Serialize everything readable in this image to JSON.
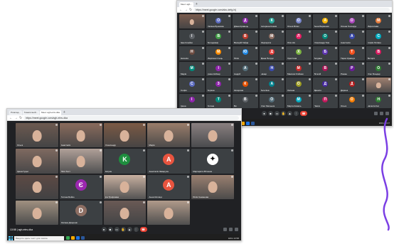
{
  "colors": {
    "meet_bg": "#202124",
    "tile_bg": "#3c4043",
    "end_call": "#ea4335",
    "squiggle": "#7b3fe4",
    "taskbar": "#1f1f1f"
  },
  "back_window": {
    "tabs": [
      "Meet: agh..."
    ],
    "address": "https://meet.google.com/abc-defg-hij",
    "bottom_left": "13:27 | agh-etnv-dka",
    "taskbar_search": "Введите здесь текст для поиска",
    "tray": "ENG 13:27",
    "tiles": [
      {
        "name": "",
        "type": "cam",
        "c": "#7a5c4e"
      },
      {
        "name": "Оксана Бушкова",
        "type": "av",
        "l": "О",
        "c": "#5c6bc0"
      },
      {
        "name": "Діана Кравець",
        "type": "av",
        "l": "Д",
        "c": "#8e24aa"
      },
      {
        "name": "Катерина Кожма",
        "type": "av",
        "l": "К",
        "c": "#26a69a"
      },
      {
        "name": "Ольга Білик",
        "type": "av",
        "l": "О",
        "c": "#7986cb"
      },
      {
        "name": "Анна Баранник",
        "type": "av",
        "l": "А",
        "c": "#f4b400"
      },
      {
        "name": "Олена Гончарук",
        "type": "av",
        "l": "О",
        "c": "#ab47bc"
      },
      {
        "name": "Мирослава",
        "type": "av",
        "l": "М",
        "c": "#e67c3c"
      },
      {
        "name": "Іван Клюйко",
        "type": "av",
        "l": "І",
        "c": "#5f6368"
      },
      {
        "name": "Володимир",
        "type": "av",
        "l": "В",
        "c": "#43a047"
      },
      {
        "name": "Валерій Гайда",
        "type": "av",
        "l": "В",
        "c": "#c0392b"
      },
      {
        "name": "Маргарита",
        "type": "av",
        "l": "М",
        "c": "#8d6e63"
      },
      {
        "name": "Ліля Ніч",
        "type": "av",
        "l": "Л",
        "c": "#e91e63"
      },
      {
        "name": "Олександр Тим",
        "type": "av",
        "l": "О",
        "c": "#00897b"
      },
      {
        "name": "Анастасія",
        "type": "av",
        "l": "А",
        "c": "#3949ab"
      },
      {
        "name": "Софія Литвин",
        "type": "av",
        "l": "С",
        "c": "#00acc1"
      },
      {
        "name": "Наталія",
        "type": "av",
        "l": "Н",
        "c": "#6d4c41"
      },
      {
        "name": "Мартина Стець",
        "type": "av",
        "l": "М",
        "c": "#fb8c00"
      },
      {
        "name": "Юлія",
        "type": "av",
        "l": "Ю",
        "c": "#1e88e5"
      },
      {
        "name": "Діана Петрук",
        "type": "av",
        "l": "Д",
        "c": "#e53935"
      },
      {
        "name": "Христина",
        "type": "av",
        "l": "Х",
        "c": "#7cb342"
      },
      {
        "name": "Богдана",
        "type": "av",
        "l": "Б",
        "c": "#5e35b1"
      },
      {
        "name": "Тарас Кравчук",
        "type": "av",
        "l": "Т",
        "c": "#f4511e"
      },
      {
        "name": "Вікторія",
        "type": "av",
        "l": "В",
        "c": "#d81b60"
      },
      {
        "name": "Марія",
        "type": "av",
        "l": "М",
        "c": "#00897b"
      },
      {
        "name": "Ірина Кобзар",
        "type": "av",
        "l": "І",
        "c": "#8e24aa"
      },
      {
        "name": "Андрій",
        "type": "av",
        "l": "А",
        "c": "#546e7a"
      },
      {
        "name": "Назар",
        "type": "av",
        "l": "Н",
        "c": "#3949ab"
      },
      {
        "name": "Максим Олійник",
        "type": "av",
        "l": "М",
        "c": "#c62828"
      },
      {
        "name": "Віталій",
        "type": "av",
        "l": "В",
        "c": "#ad1457"
      },
      {
        "name": "Роман",
        "type": "av",
        "l": "Р",
        "c": "#6a1b9a"
      },
      {
        "name": "Олег Бондар",
        "type": "av",
        "l": "О",
        "c": "#2e7d32"
      },
      {
        "name": "Софія",
        "type": "av",
        "l": "С",
        "c": "#5c6bc0"
      },
      {
        "name": "Зоряна",
        "type": "av",
        "l": "З",
        "c": "#8e24aa"
      },
      {
        "name": "Катерина",
        "type": "av",
        "l": "К",
        "c": "#e65100"
      },
      {
        "name": "Ангеліна",
        "type": "av",
        "l": "А",
        "c": "#00838f"
      },
      {
        "name": "Оксана",
        "type": "av",
        "l": "О",
        "c": "#9e9d24"
      },
      {
        "name": "Данило",
        "type": "av",
        "l": "Д",
        "c": "#4527a0"
      },
      {
        "name": "Дарина",
        "type": "av",
        "l": "Д",
        "c": "#b71c1c"
      },
      {
        "name": "",
        "type": "cam",
        "c": "#a08070"
      },
      {
        "name": "Ірина",
        "type": "av",
        "l": "І",
        "c": "#8e24aa"
      },
      {
        "name": "Тетяна",
        "type": "av",
        "l": "Т",
        "c": "#00897b"
      },
      {
        "name": "Ви",
        "type": "av",
        "l": "В",
        "c": "#5f6368"
      },
      {
        "name": "Олег Мельник",
        "type": "av",
        "l": "О",
        "c": "#546e7a"
      },
      {
        "name": "Марта Коваль",
        "type": "av",
        "l": "М",
        "c": "#00acc1"
      },
      {
        "name": "Павло",
        "type": "av",
        "l": "П",
        "c": "#c2185b"
      },
      {
        "name": "Ольга",
        "type": "av",
        "l": "О",
        "c": "#f57c00"
      },
      {
        "name": "Наталія Кос",
        "type": "av",
        "l": "Н",
        "c": "#2e7d32"
      }
    ]
  },
  "front_window": {
    "tabs": [
      "Розклад...",
      "Тематичний...",
      "Meet: agh-etnv-dka"
    ],
    "address": "https://meet.google.com/agh-etnv-dka",
    "bottom_left": "13:58 | agh-etnv-dka",
    "taskbar_search": "Введите здесь текст для поиска",
    "tray": "ENG 13:58",
    "tiles": [
      {
        "name": "Ольга",
        "type": "cam",
        "c": "#6d5a50"
      },
      {
        "name": "Анастасія",
        "type": "cam",
        "c": "#8a6b5c"
      },
      {
        "name": "Олександр",
        "type": "cam",
        "c": "#7c5a45"
      },
      {
        "name": "Марія",
        "type": "cam",
        "c": "#9a7d6a"
      },
      {
        "name": "",
        "type": "cam",
        "c": "#8a8080"
      },
      {
        "name": "Ірина Гуцал",
        "type": "cam",
        "c": "#7f6a60"
      },
      {
        "name": "Ліля Тест",
        "type": "cam",
        "c": "#b0a098"
      },
      {
        "name": "Катрин",
        "type": "av",
        "l": "K",
        "c": "#1e8e3e"
      },
      {
        "name": "Анастасія Заверуха",
        "type": "av",
        "l": "A",
        "c": "#e8543f"
      },
      {
        "name": "Маргарита Вітошка",
        "type": "logo",
        "c": "#ffffff"
      },
      {
        "name": "",
        "type": "cam",
        "c": "#5d4a44"
      },
      {
        "name": "Тетяна Бойко",
        "type": "av",
        "l": "Є",
        "c": "#9c27b0"
      },
      {
        "name": "Іра Трофимюк",
        "type": "cam",
        "c": "#c8b0a0"
      },
      {
        "name": "Анна Кіслиця",
        "type": "av",
        "l": "A",
        "c": "#e8543f"
      },
      {
        "name": "Юлія Семенова",
        "type": "cam",
        "c": "#9a8070"
      },
      {
        "name": "",
        "type": "cam",
        "c": "#a09080"
      },
      {
        "name": "Оксана Дзюрник",
        "type": "av",
        "l": "D",
        "c": "#8d6e63"
      },
      {
        "name": "",
        "type": "cam",
        "c": "#6a5a55"
      },
      {
        "name": "",
        "type": "cam",
        "c": "#b09a8a"
      }
    ]
  }
}
